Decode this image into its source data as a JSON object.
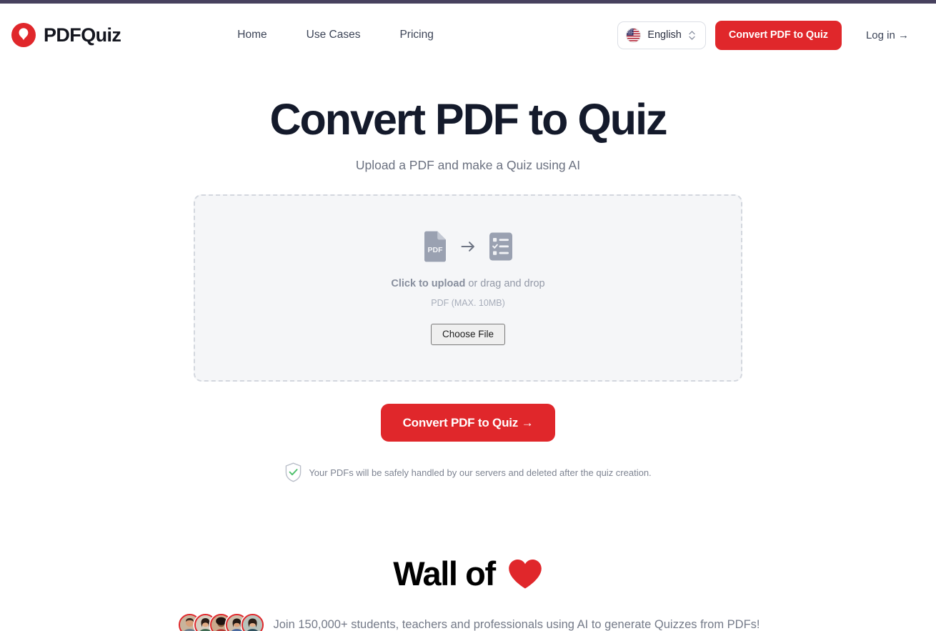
{
  "header": {
    "brand": {
      "name": "PDFQuiz",
      "logo_icon": "pin-circle-logo",
      "accent_color": "#e0272b"
    },
    "nav": [
      {
        "label": "Home",
        "name": "nav-home"
      },
      {
        "label": "Use Cases",
        "name": "nav-use-cases"
      },
      {
        "label": "Pricing",
        "name": "nav-pricing"
      }
    ],
    "language": {
      "label": "English",
      "flag_icon": "us-flag-icon",
      "chevron_icon": "chevron-up-down-icon"
    },
    "cta_label": "Convert PDF to Quiz",
    "login_label": "Log in →"
  },
  "hero": {
    "title": "Convert PDF to Quiz",
    "subtitle": "Upload a PDF and make a Quiz using AI"
  },
  "dropzone": {
    "from_icon": "pdf-file-icon",
    "arrow_icon": "arrow-right-icon",
    "to_icon": "quiz-checklist-icon",
    "click_label": "Click to upload",
    "drag_label": " or drag and drop",
    "hint": "PDF (MAX. 10MB)",
    "choose_file_label": "Choose File"
  },
  "convert": {
    "label": "Convert PDF to Quiz →"
  },
  "privacy": {
    "icon": "shield-check-icon",
    "text": "Your PDFs will be safely handled by our servers and deleted after the quiz creation.",
    "check_color": "#4cbf6a"
  },
  "wall": {
    "title": "Wall of",
    "heart_icon": "heart-icon",
    "heart_color": "#e0272b",
    "social_text": "Join 150,000+ students, teachers and professionals using AI to generate Quizzes from PDFs!",
    "avatars": [
      {
        "name": "avatar-1",
        "skin": "#d8a07a",
        "hair": "#3a2b22",
        "shirt": "#6f7f8f",
        "bg": "#c8b49c"
      },
      {
        "name": "avatar-2",
        "skin": "#e0ac85",
        "hair": "#2a1d17",
        "shirt": "#3f6b52",
        "bg": "#d7cec0"
      },
      {
        "name": "avatar-3",
        "skin": "#8a5c3c",
        "hair": "#1d1310",
        "shirt": "#b63b36",
        "bg": "#caa98c"
      },
      {
        "name": "avatar-4",
        "skin": "#d9a079",
        "hair": "#241a14",
        "shirt": "#4a6aa0",
        "bg": "#cdbda9"
      },
      {
        "name": "avatar-5",
        "skin": "#e3b18d",
        "hair": "#2d1f17",
        "shirt": "#30515f",
        "bg": "#b8c2bb"
      }
    ]
  }
}
